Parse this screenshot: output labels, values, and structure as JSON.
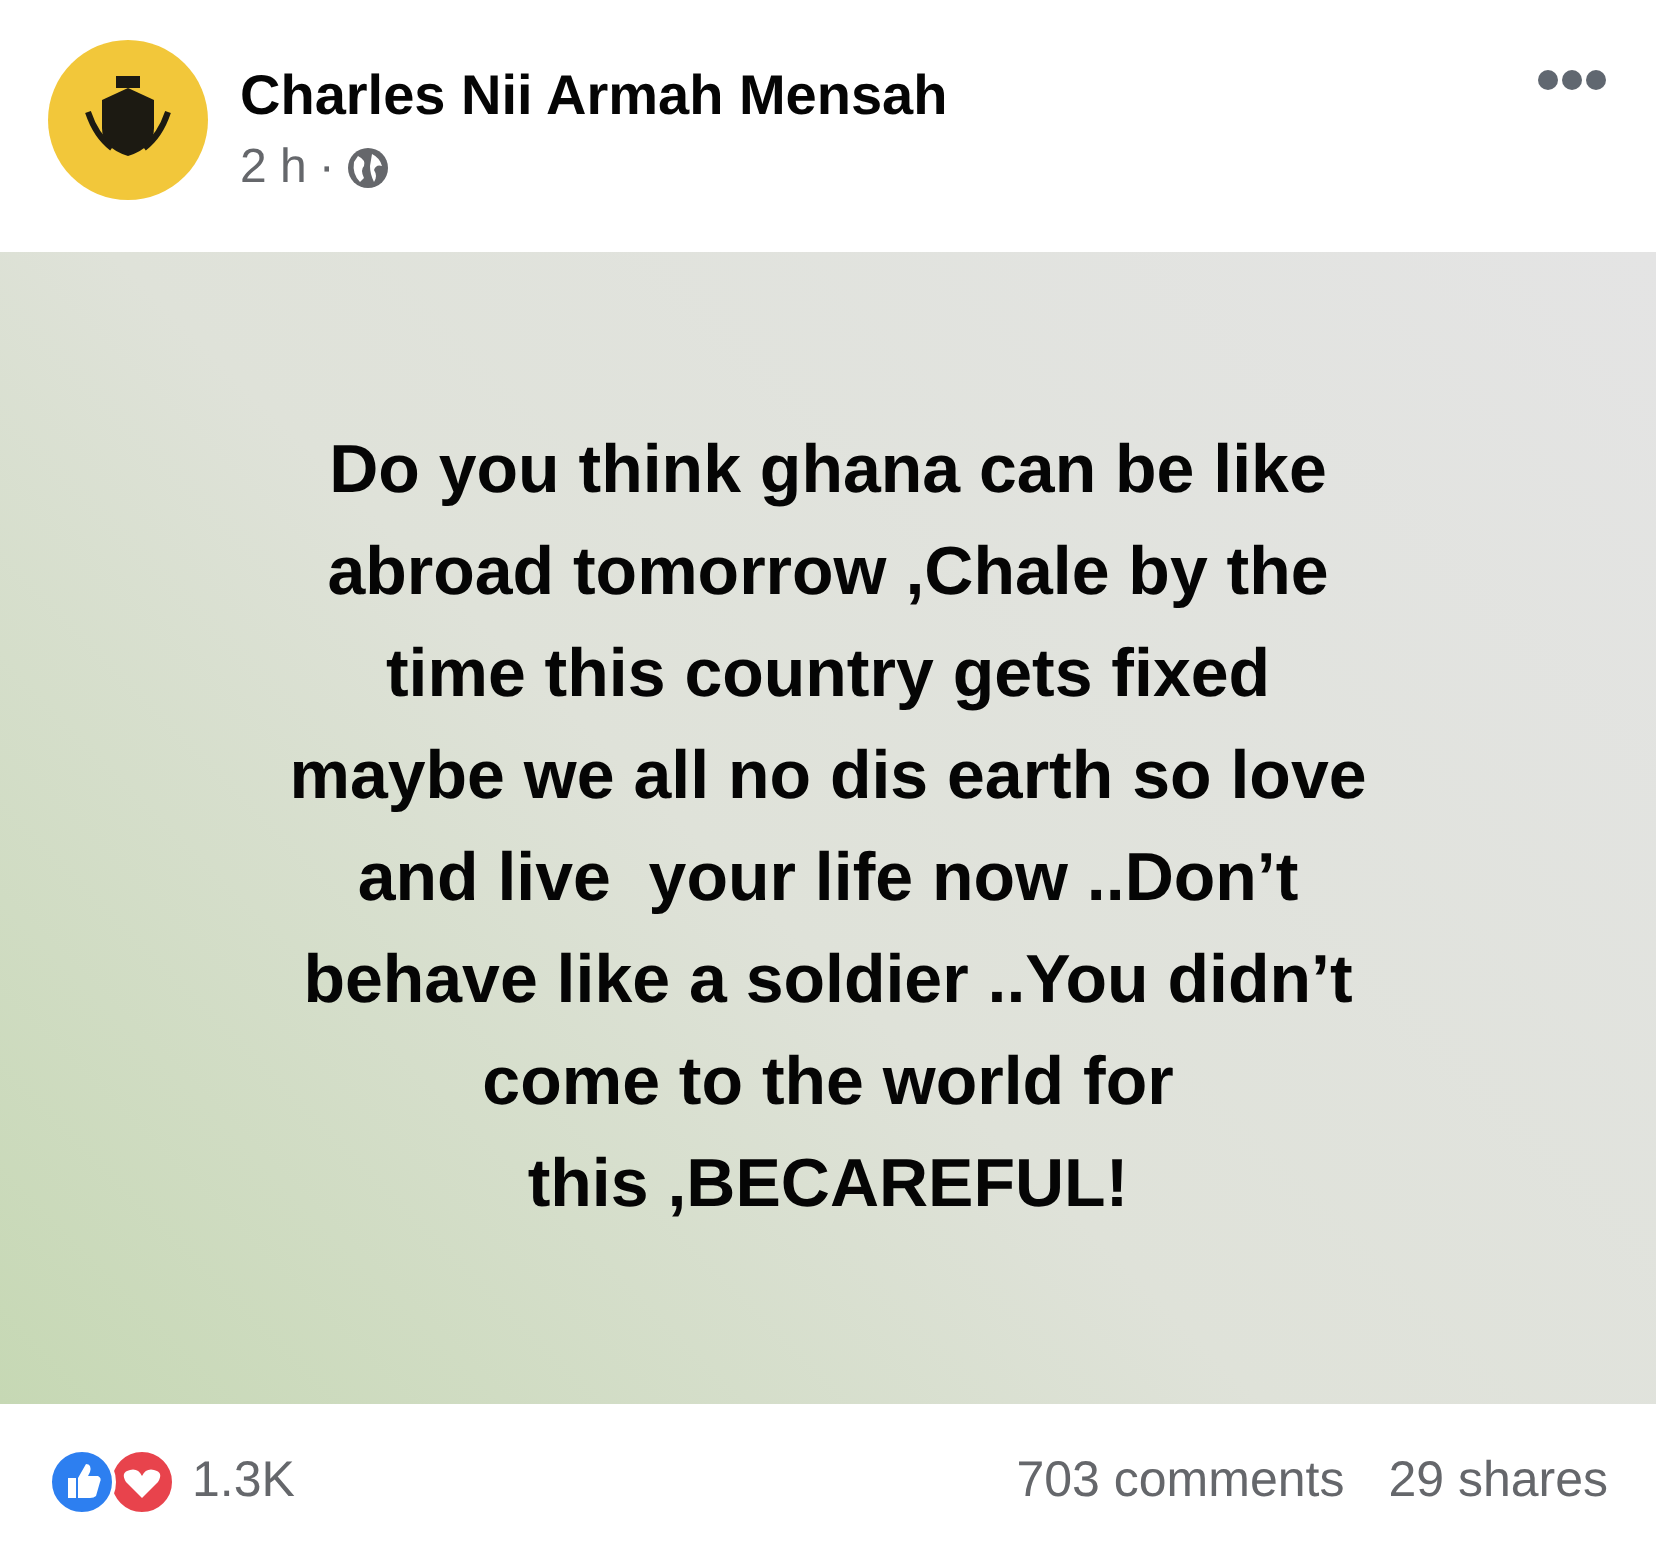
{
  "post": {
    "author": "Charles Nii Armah Mensah",
    "time": "2 h",
    "separator": "·",
    "text_lines": [
      "Do you think ghana can be like",
      "abroad tomorrow ,Chale by the",
      "time this country gets fixed",
      "maybe we all no dis earth so love",
      "and live  your life now ..Don’t",
      "behave like a soldier ..You didn’t",
      "come to the world for",
      "this ,BECAREFUL!"
    ]
  },
  "footer": {
    "reactions_count": "1.3K",
    "comments": "703 comments",
    "shares": "29 shares"
  }
}
